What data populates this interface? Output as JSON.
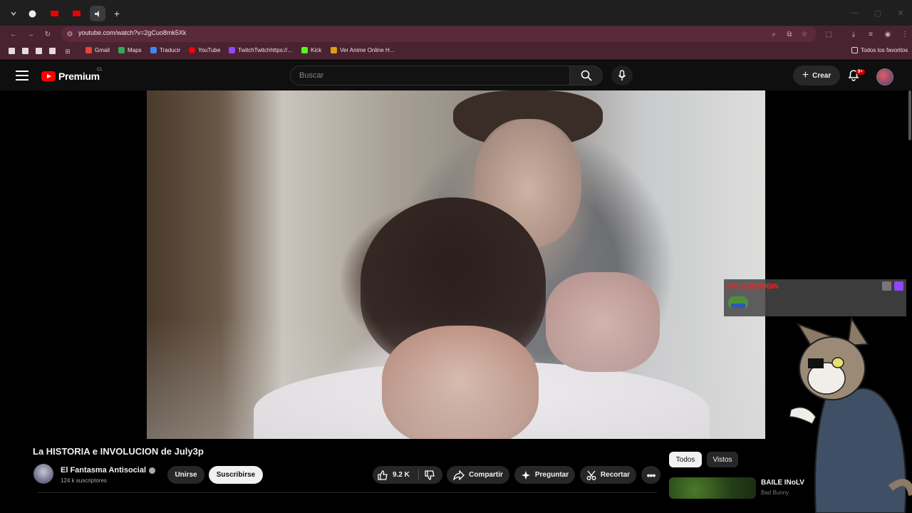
{
  "browser": {
    "url": "youtube.com/watch?v=2gCuo8mk5Xk",
    "bookmarks": [
      {
        "label": "Gmail",
        "color": "#ea4335"
      },
      {
        "label": "Maps",
        "color": "#34a853"
      },
      {
        "label": "Traducir",
        "color": "#4285f4"
      },
      {
        "label": "YouTube",
        "color": "#ff0000"
      },
      {
        "label": "TwitchTwitchhttps://...",
        "color": "#9146ff"
      },
      {
        "label": "Kick",
        "color": "#53fc18"
      },
      {
        "label": "Ver Anime Online H...",
        "color": "#d4a017"
      }
    ],
    "all_bookmarks": "Todos los favoritos"
  },
  "youtube": {
    "logo_text": "Premium",
    "country_code": "CL",
    "search_placeholder": "Buscar",
    "create_label": "Crear",
    "notification_count": "9+"
  },
  "overlay": {
    "username": "MR_QUERUBIN"
  },
  "video": {
    "title": "La HISTORIA e INVOLUCION de July3p",
    "channel": "El Fantasma Antisocial",
    "subscribers": "124 k suscriptores",
    "join_label": "Unirse",
    "subscribe_label": "Suscribirse",
    "likes": "9.2 K",
    "share_label": "Compartir",
    "ask_label": "Preguntar",
    "clip_label": "Recortar"
  },
  "sidebar": {
    "chips": [
      "Todos",
      "Vistos"
    ],
    "rec_title": "BAILE INoLV",
    "rec_channel": "Bad Bunny"
  }
}
